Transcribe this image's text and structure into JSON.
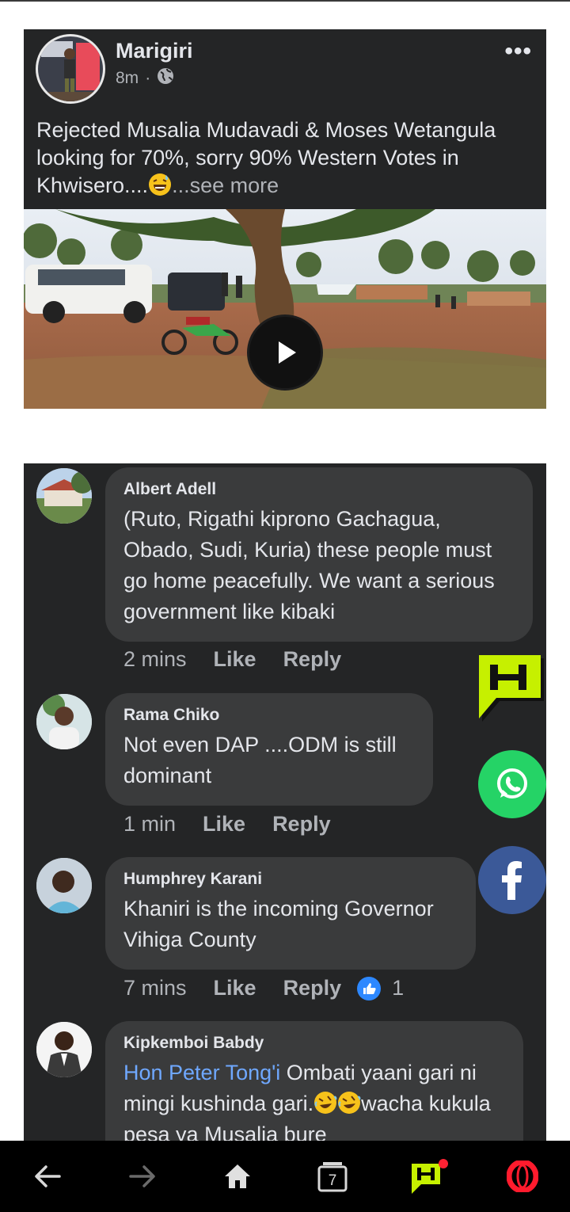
{
  "post": {
    "author": "Marigiri",
    "time": "8m",
    "dot": "·",
    "text": "Rejected Musalia Mudavadi & Moses Wetangula looking for 70%, sorry 90% Western Votes in Khwisero....",
    "see_more": "...see more",
    "more_icon": "more-dots-icon",
    "privacy_icon": "globe-icon"
  },
  "comments": [
    {
      "name": "Albert Adell",
      "text": "(Ruto, Rigathi kiprono Gachagua, Obado, Sudi, Kuria) these people must go home peacefully. We want a serious government like kibaki",
      "time": "2 mins",
      "like": "Like",
      "reply": "Reply"
    },
    {
      "name": "Rama Chiko",
      "text": "Not even DAP ....ODM is still dominant",
      "time": "1 min",
      "like": "Like",
      "reply": "Reply"
    },
    {
      "name": "Humphrey Karani",
      "text": "Khaniri is the incoming Governor Vihiga County",
      "time": "7 mins",
      "like": "Like",
      "reply": "Reply",
      "reaction_count": "1"
    },
    {
      "name": "Kipkemboi Babdy",
      "mention": "Hon Peter Tong'i",
      "text_a": " Ombati yaani gari ni mingi kushinda gari.",
      "text_b": "wacha kukula pesa ya Musalia bure"
    }
  ],
  "share": {
    "whatsapp_icon": "whatsapp-icon",
    "facebook_icon": "facebook-icon",
    "h_icon": "h-logo-icon"
  },
  "nav": {
    "tab_count": "7",
    "colors": {
      "bar": "#000000",
      "opera_red": "#ff1b2d",
      "accent_green": "#c6f000"
    }
  },
  "colors": {
    "card_bg": "#242526",
    "bubble_bg": "#3a3b3c",
    "text_primary": "#e4e6eb",
    "text_secondary": "#b0b3b8",
    "mention": "#6fa8ff"
  }
}
